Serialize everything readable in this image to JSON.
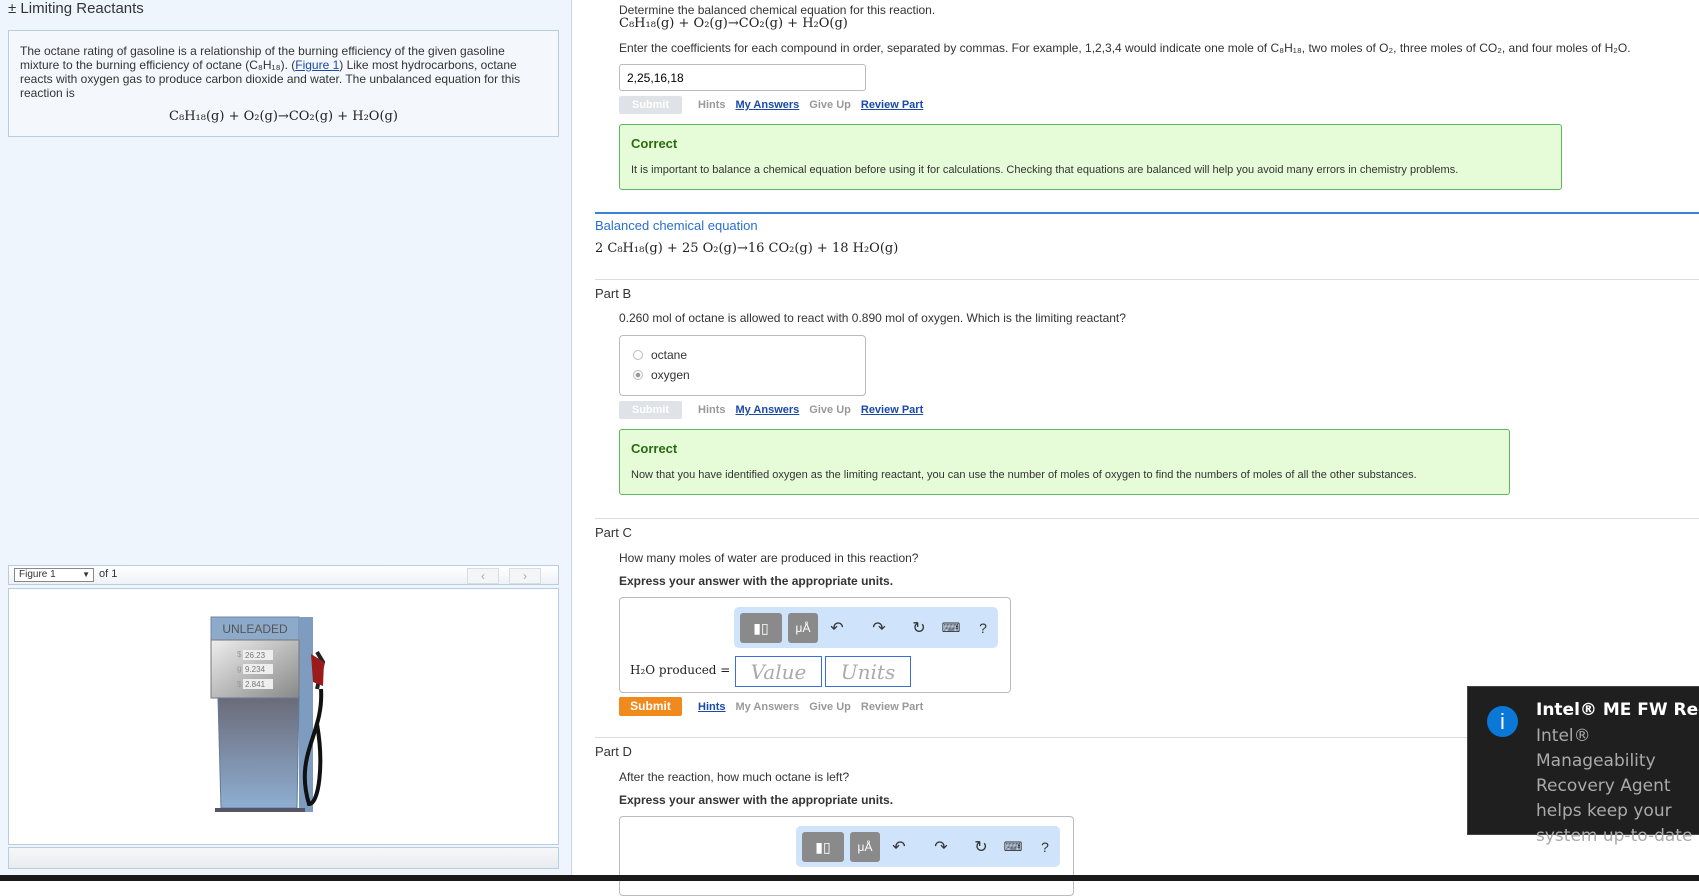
{
  "left": {
    "title": "± Limiting Reactants",
    "intro_1": "The octane rating of gasoline is a relationship of the burning efficiency of the given gasoline mixture to the burning efficiency of octane (C₈H₁₈). (",
    "figure_link": "Figure 1",
    "intro_2": ") Like most hydrocarbons, octane reacts with oxygen gas to produce carbon dioxide and water. The unbalanced equation for this reaction is",
    "equation": "C₈H₁₈(g) + O₂(g)→CO₂(g) + H₂O(g)",
    "figure_select": "Figure 1",
    "figure_of": "of 1",
    "prev": "‹",
    "next": "›",
    "pump": {
      "label": "UNLEADED",
      "price": "26.23",
      "gallons": "9.234",
      "rate": "2.841",
      "s1": "$",
      "s2": "g",
      "s3": "$"
    }
  },
  "partA": {
    "prompt": "Determine the balanced chemical equation for this reaction.",
    "equation": "C₈H₁₈(g) + O₂(g)→CO₂(g) + H₂O(g)",
    "instructions": "Enter the coefficients for each compound in order, separated by commas. For example, 1,2,3,4 would indicate one mole of C₈H₁₈, two moles of O₂, three moles of CO₂, and four moles of H₂O.",
    "answer": "2,25,16,18",
    "feedback_title": "Correct",
    "feedback": "It is important to balance a chemical equation before using it for calculations. Checking that equations are balanced will help you avoid many errors in chemistry problems.",
    "summary_label": "Balanced chemical equation",
    "summary_equation": "2 C₈H₁₈(g) + 25 O₂(g)→16 CO₂(g) + 18 H₂O(g)"
  },
  "actions": {
    "submit": "Submit",
    "hints": "Hints",
    "my_answers": "My Answers",
    "give_up": "Give Up",
    "review": "Review Part"
  },
  "partB": {
    "title": "Part B",
    "question": "0.260 mol of octane is allowed to react with 0.890 mol of oxygen. Which is the limiting reactant?",
    "options": [
      "octane",
      "oxygen"
    ],
    "selected": "oxygen",
    "feedback_title": "Correct",
    "feedback": "Now that you have identified oxygen as the limiting reactant, you can use the number of moles of oxygen to find the numbers of moles of all the other substances."
  },
  "partC": {
    "title": "Part C",
    "question": "How many moles of water are produced in this reaction?",
    "express": "Express your answer with the appropriate units.",
    "label": "H₂O produced =",
    "value_placeholder": "Value",
    "units_placeholder": "Units",
    "help": "?",
    "units_btn": "μÅ"
  },
  "partD": {
    "title": "Part D",
    "question": "After the reaction, how much octane is left?",
    "express": "Express your answer with the appropriate units."
  },
  "toast": {
    "title": "Intel® ME FW Recovery",
    "body": "Intel® Manageability Recovery Agent helps keep your system up-to-date"
  },
  "colors": {
    "accent": "#1a49a8",
    "submit": "#f08a1c",
    "correct_bg": "#e6fbd8",
    "correct_border": "#5cb85c"
  }
}
